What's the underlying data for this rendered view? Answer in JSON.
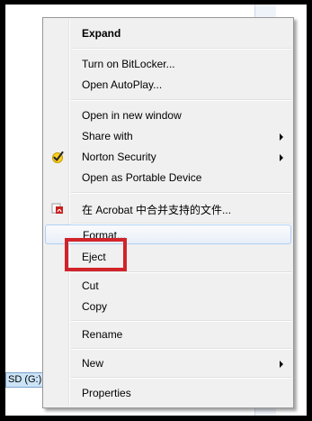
{
  "menu": {
    "expand": "Expand",
    "bitlocker": "Turn on BitLocker...",
    "autoplay": "Open AutoPlay...",
    "new_window": "Open in new window",
    "share_with": "Share with",
    "norton": "Norton Security",
    "portable": "Open as Portable Device",
    "acrobat": "在 Acrobat 中合并支持的文件...",
    "format": "Format...",
    "eject": "Eject",
    "cut": "Cut",
    "copy": "Copy",
    "rename": "Rename",
    "new": "New",
    "properties": "Properties"
  },
  "explorer": {
    "drive_label": "SD (G:)"
  },
  "colors": {
    "highlight_box": "#d1232a",
    "hover_border": "#aecff7",
    "selection": "#cce4f7"
  },
  "icons": {
    "norton": "norton-check-icon",
    "acrobat": "acrobat-icon"
  }
}
